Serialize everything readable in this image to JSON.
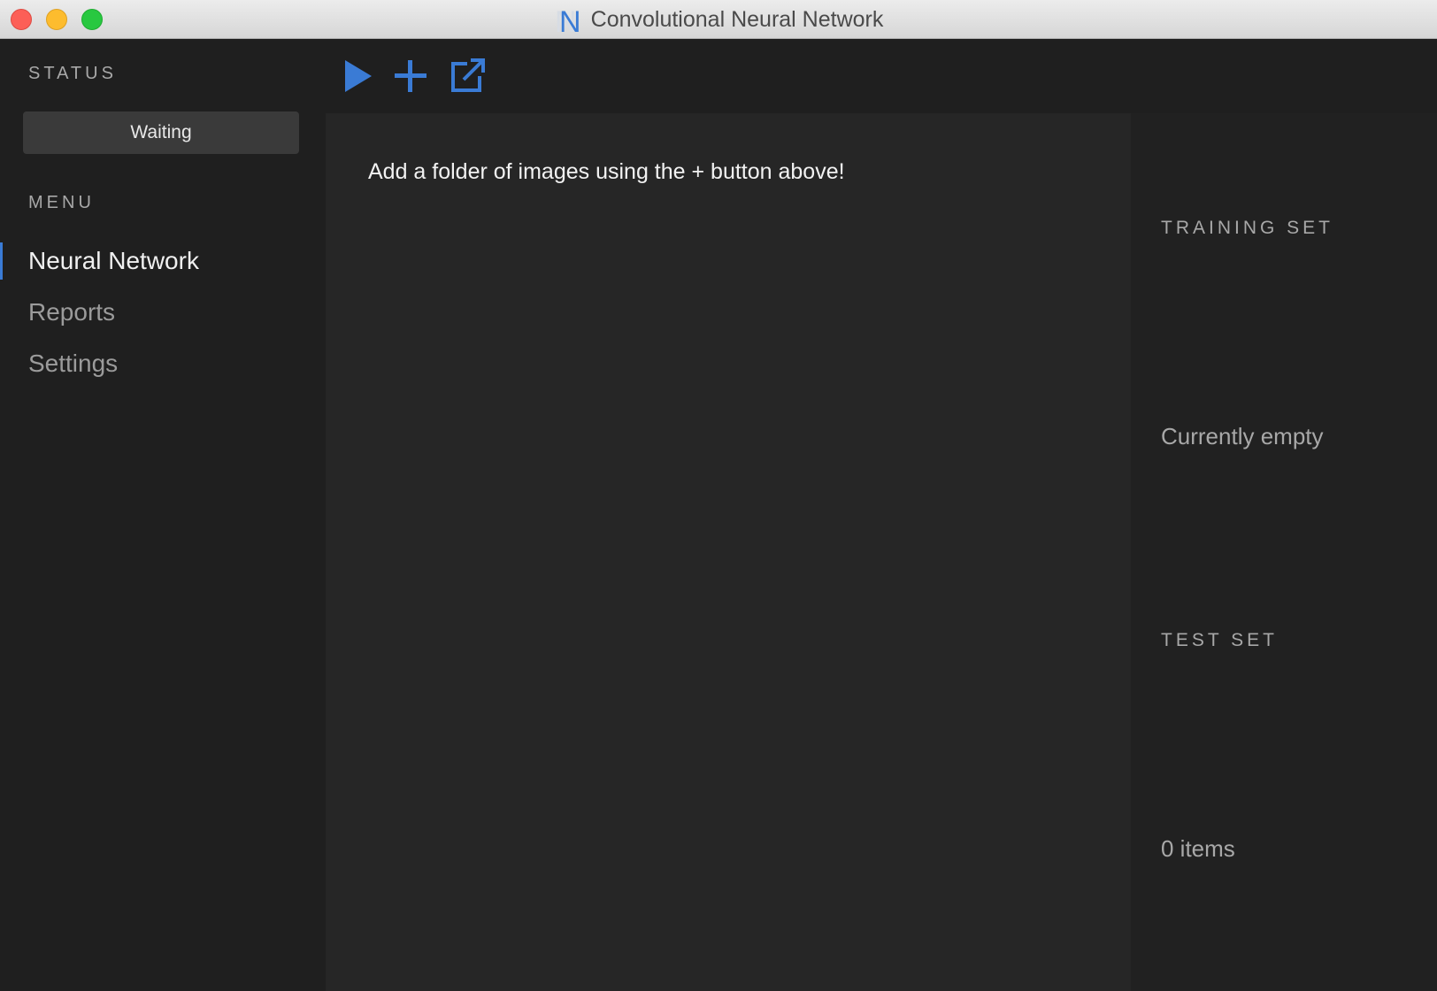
{
  "window": {
    "title": "Convolutional Neural Network",
    "logo": "N"
  },
  "sidebar": {
    "status_label": "STATUS",
    "status_value": "Waiting",
    "menu_label": "MENU",
    "items": [
      {
        "label": "Neural Network",
        "active": true
      },
      {
        "label": "Reports",
        "active": false
      },
      {
        "label": "Settings",
        "active": false
      }
    ]
  },
  "toolbar": {
    "buttons": [
      {
        "icon": "play-icon"
      },
      {
        "icon": "plus-icon"
      },
      {
        "icon": "external-link-icon"
      }
    ],
    "accent_color": "#3a7bd5"
  },
  "main": {
    "hint": "Add a folder of images using the + button above!"
  },
  "right_panel": {
    "training_label": "TRAINING SET",
    "training_value": "Currently empty",
    "test_label": "TEST SET",
    "test_value": "0 items"
  }
}
